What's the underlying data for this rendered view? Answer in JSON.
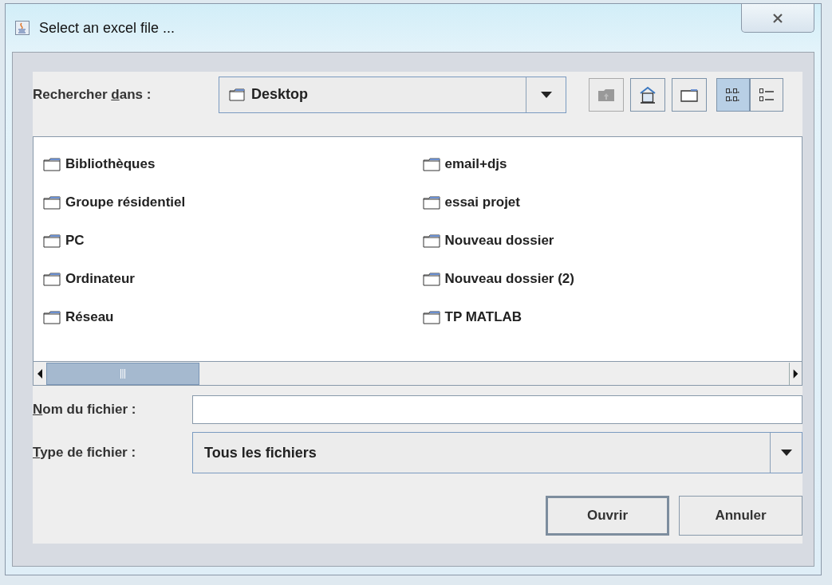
{
  "window": {
    "title": "Select an excel file ..."
  },
  "look_in": {
    "label_before": "Rechercher ",
    "mnemonic": "d",
    "label_after": "ans :",
    "value": "Desktop"
  },
  "toolbar": [
    {
      "kind": "up",
      "disabled": true
    },
    {
      "kind": "home",
      "disabled": false
    },
    {
      "kind": "new-folder",
      "disabled": false
    }
  ],
  "view_modes": [
    {
      "kind": "list",
      "selected": true
    },
    {
      "kind": "details",
      "selected": false
    }
  ],
  "files": [
    {
      "name": "Bibliothèques"
    },
    {
      "name": "Groupe résidentiel"
    },
    {
      "name": "PC"
    },
    {
      "name": "Ordinateur"
    },
    {
      "name": "Réseau"
    },
    {
      "name": "email+djs"
    },
    {
      "name": "essai projet"
    },
    {
      "name": "Nouveau dossier"
    },
    {
      "name": "Nouveau dossier (2)"
    },
    {
      "name": "TP MATLAB"
    }
  ],
  "file_name": {
    "mnemonic": "N",
    "label_after": "om du fichier :"
  },
  "file_type": {
    "mnemonic": "T",
    "label_after": "ype de fichier :",
    "value": "Tous les fichiers"
  },
  "buttons": [
    {
      "label": "Ouvrir",
      "default": true
    },
    {
      "label": "Annuler",
      "default": false
    }
  ]
}
